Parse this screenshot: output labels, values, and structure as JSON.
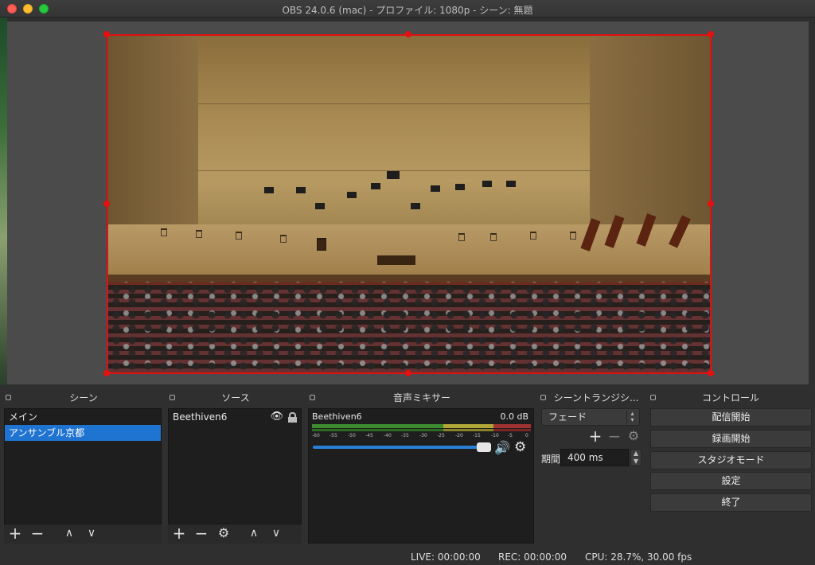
{
  "window": {
    "title": "OBS 24.0.6 (mac) - プロファイル: 1080p - シーン: 無題"
  },
  "scenes_dock": {
    "title": "シーン",
    "items": [
      {
        "label": "メイン",
        "selected": false
      },
      {
        "label": "アンサンブル京都",
        "selected": true
      }
    ]
  },
  "sources_dock": {
    "title": "ソース",
    "items": [
      {
        "label": "Beethiven6",
        "visible": true,
        "locked": false
      }
    ]
  },
  "mixer_dock": {
    "title": "音声ミキサー",
    "channel": {
      "name": "Beethiven6",
      "db": "0.0 dB",
      "scale": [
        "-60",
        "-55",
        "-50",
        "-45",
        "-40",
        "-35",
        "-30",
        "-25",
        "-20",
        "-15",
        "-10",
        "-5",
        "0"
      ],
      "volume_level": 1.0
    }
  },
  "transitions_dock": {
    "title": "シーントランジシ...",
    "transition": "フェード",
    "duration_label": "期間",
    "duration_value": "400 ms"
  },
  "controls_dock": {
    "title": "コントロール",
    "buttons": [
      "配信開始",
      "録画開始",
      "スタジオモード",
      "設定",
      "終了"
    ]
  },
  "status": {
    "live": "LIVE: 00:00:00",
    "rec": "REC: 00:00:00",
    "cpu": "CPU: 28.7%, 30.00 fps"
  },
  "icons": {
    "add": "plus-icon",
    "remove": "minus-icon",
    "up": "chevron-up-icon",
    "down": "chevron-down-icon",
    "settings": "gear-icon",
    "eye": "eye-icon",
    "lock": "lock-icon",
    "speaker": "speaker-icon"
  },
  "colors": {
    "selection": "#1f73d1",
    "preview_border": "#e01010",
    "meter_green": "#3c8b2f",
    "meter_yellow": "#b2a636",
    "meter_red": "#a13232"
  }
}
